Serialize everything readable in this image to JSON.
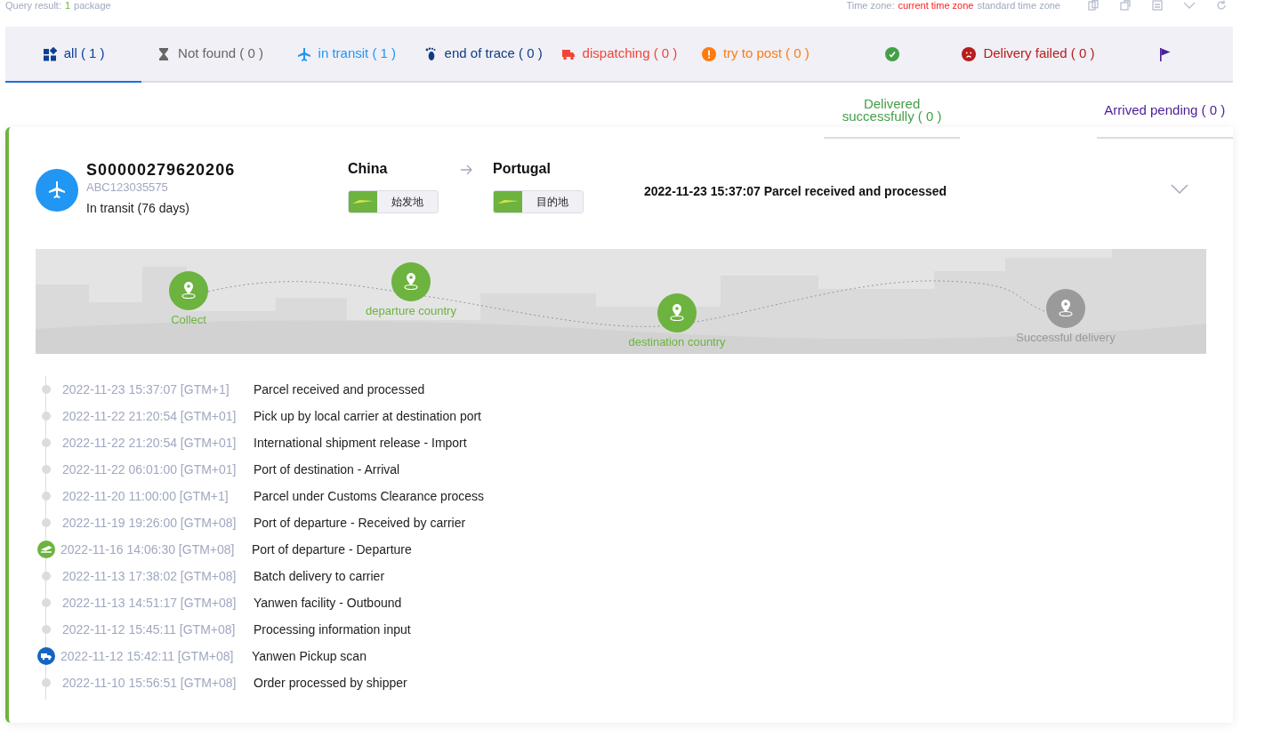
{
  "header": {
    "query_label": "Query result:",
    "query_count": "1",
    "query_unit": "package",
    "timezone_label": "Time zone:",
    "timezone_current": "current time zone",
    "timezone_standard": "standard time zone"
  },
  "tabs": [
    {
      "kind": "all",
      "label": "all ( 1 )",
      "selected": true,
      "color": "#0d3f95"
    },
    {
      "kind": "notfound",
      "label": "Not found ( 0 )",
      "selected": false,
      "color": "#666666"
    },
    {
      "kind": "transit",
      "label": "in transit ( 1 )",
      "selected": false,
      "color": "#2196f3"
    },
    {
      "kind": "endtrace",
      "label": "end of trace ( 0 )",
      "selected": false,
      "color": "#123c82"
    },
    {
      "kind": "dispatching",
      "label": "dispatching ( 0 )",
      "selected": false,
      "color": "#f44336"
    },
    {
      "kind": "trypost",
      "label": "try to post ( 0 )",
      "selected": false,
      "color": "#ff7a0f"
    },
    {
      "kind": "delivered",
      "label": "Delivered successfully ( 0 )",
      "selected": false,
      "color": "#43a047",
      "label_below": true
    },
    {
      "kind": "failed",
      "label": "Delivery failed ( 0 )",
      "selected": false,
      "color": "#b71c1c"
    },
    {
      "kind": "pending",
      "label": "Arrived pending ( 0 )",
      "selected": false,
      "color": "#4a1e98",
      "label_below": true
    }
  ],
  "parcel": {
    "tracking_number": "S00000279620206",
    "reference": "ABC123035575",
    "status": "In transit (76 days)",
    "origin": "China",
    "origin_tag": "始发地",
    "destination": "Portugal",
    "destination_tag": "目的地",
    "latest_event": "2022-11-23 15:37:07 Parcel received and processed",
    "expanded": false
  },
  "progress": [
    {
      "label": "Collect",
      "reached": true
    },
    {
      "label": "departure country",
      "reached": true
    },
    {
      "label": "destination country",
      "reached": true
    },
    {
      "label": "Successful delivery",
      "reached": false
    }
  ],
  "events": [
    {
      "kind": "dot",
      "time": "2022-11-23 15:37:07 [GTM+1]",
      "text": "Parcel received and processed"
    },
    {
      "kind": "dot",
      "time": "2022-11-22 21:20:54 [GTM+01]",
      "text": "Pick up by local carrier at destination port"
    },
    {
      "kind": "dot",
      "time": "2022-11-22 21:20:54 [GTM+01]",
      "text": "International shipment release - Import"
    },
    {
      "kind": "dot",
      "time": "2022-11-22 06:01:00 [GTM+01]",
      "text": "Port of destination - Arrival"
    },
    {
      "kind": "dot",
      "time": "2022-11-20 11:00:00 [GTM+1]",
      "text": "Parcel under Customs Clearance process"
    },
    {
      "kind": "dot",
      "time": "2022-11-19 19:26:00 [GTM+08]",
      "text": "Port of departure - Received by carrier"
    },
    {
      "kind": "plane",
      "time": "2022-11-16 14:06:30 [GTM+08]",
      "text": "Port of departure - Departure"
    },
    {
      "kind": "dot",
      "time": "2022-11-13 17:38:02 [GTM+08]",
      "text": "Batch delivery to carrier"
    },
    {
      "kind": "dot",
      "time": "2022-11-13 14:51:17 [GTM+08]",
      "text": "Yanwen facility - Outbound"
    },
    {
      "kind": "dot",
      "time": "2022-11-12 15:45:11 [GTM+08]",
      "text": "Processing information input"
    },
    {
      "kind": "truck",
      "time": "2022-11-12 15:42:11 [GTM+08]",
      "text": "Yanwen Pickup scan"
    },
    {
      "kind": "dot",
      "time": "2022-11-10 15:56:51 [GTM+08]",
      "text": "Order processed by shipper"
    }
  ]
}
